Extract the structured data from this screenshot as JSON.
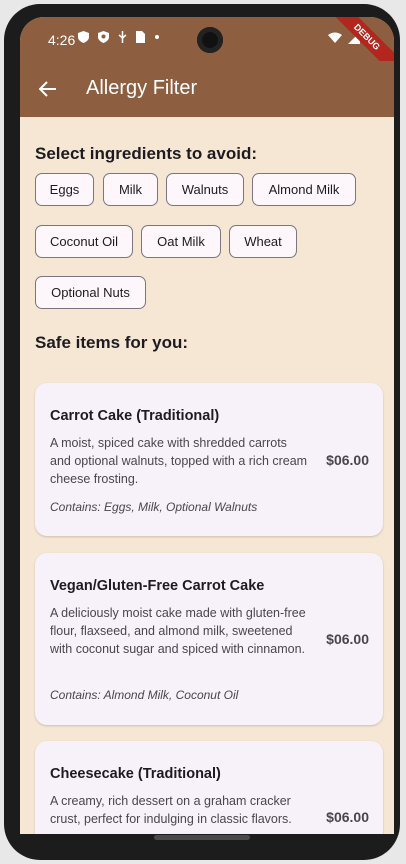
{
  "status_bar": {
    "time": "4:26",
    "left_icons": [
      "shield-icon",
      "vpn-icon",
      "usb-icon",
      "sim-icon",
      "dot"
    ],
    "right_icons": [
      "wifi-icon",
      "signal-icon",
      "battery-icon"
    ],
    "debug_label": "DEBUG"
  },
  "app_bar": {
    "title": "Allergy Filter",
    "back_icon": "arrow-back-icon",
    "color": "#8d5e3f"
  },
  "filter": {
    "heading": "Select ingredients to avoid:",
    "chips": [
      "Eggs",
      "Milk",
      "Walnuts",
      "Almond Milk",
      "Coconut Oil",
      "Oat Milk",
      "Wheat",
      "Optional Nuts"
    ]
  },
  "results": {
    "heading": "Safe items for you:",
    "items": [
      {
        "name": "Carrot Cake (Traditional)",
        "description": "A moist, spiced cake with shredded carrots and optional walnuts, topped with a rich cream cheese frosting.",
        "contains": "Contains: Eggs, Milk, Optional Walnuts",
        "price": "$06.00"
      },
      {
        "name": "Vegan/Gluten-Free Carrot Cake",
        "description": "A deliciously moist cake made with gluten-free flour, flaxseed, and almond milk, sweetened with coconut sugar and spiced with cinnamon.",
        "contains": "Contains: Almond Milk, Coconut Oil",
        "price": "$06.00"
      },
      {
        "name": "Cheesecake (Traditional)",
        "description": "A creamy, rich dessert on a graham cracker crust, perfect for indulging in classic flavors.",
        "price": "$06.00"
      }
    ]
  },
  "colors": {
    "background": "#f6e7d4",
    "card": "#f7f2fa",
    "chip": "#fdf7fb"
  }
}
